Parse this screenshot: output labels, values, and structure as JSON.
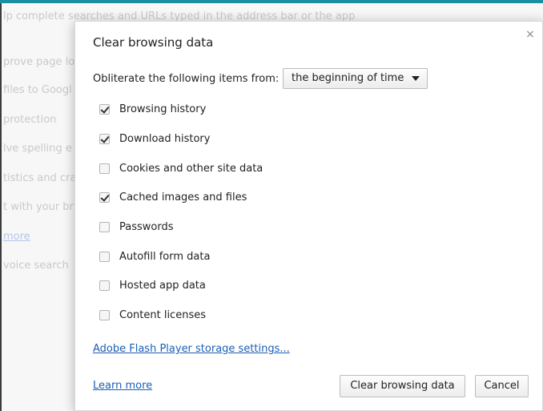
{
  "background": {
    "lines": [
      "lp complete searches and URLs typed in the address bar or the app",
      "prove page lo",
      "files to Googl",
      " protection",
      "lve spelling e",
      "tistics and cra",
      "t with your br",
      "more",
      "voice search"
    ]
  },
  "dialog": {
    "title": "Clear browsing data",
    "close_glyph": "×",
    "timeframe_label": "Obliterate the following items from:",
    "timeframe_value": "the beginning of time",
    "items": [
      {
        "label": "Browsing history",
        "checked": true
      },
      {
        "label": "Download history",
        "checked": true
      },
      {
        "label": "Cookies and other site data",
        "checked": false
      },
      {
        "label": "Cached images and files",
        "checked": true
      },
      {
        "label": "Passwords",
        "checked": false
      },
      {
        "label": "Autofill form data",
        "checked": false
      },
      {
        "label": "Hosted app data",
        "checked": false
      },
      {
        "label": "Content licenses",
        "checked": false
      }
    ],
    "flash_link": "Adobe Flash Player storage settings...",
    "learn_more": "Learn more",
    "clear_button": "Clear browsing data",
    "cancel_button": "Cancel"
  },
  "colors": {
    "accent_bar": "#1a8fa0",
    "link": "#1a5fb4"
  }
}
